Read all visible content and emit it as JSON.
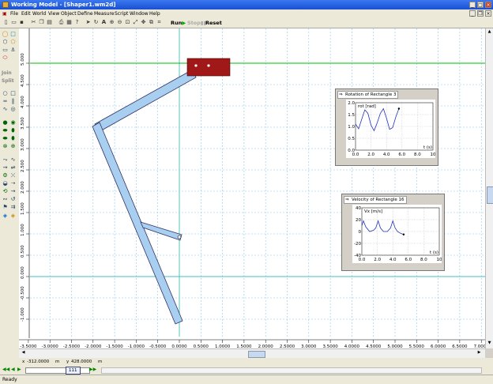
{
  "window": {
    "title": "Working Model - [Shaper1.wm2d]"
  },
  "menu": [
    "File",
    "Edit",
    "World",
    "View",
    "Object",
    "Define",
    "Measure",
    "Script",
    "Window",
    "Help"
  ],
  "toolbar": {
    "run_label": "Run",
    "stop_label": "Stop",
    "reset_label": "Reset"
  },
  "palette": {
    "join_label": "Join",
    "split_label": "Split"
  },
  "canvas": {
    "x_ticks": [
      "-4.000",
      "-3.5000",
      "-3.0000",
      "-2.5000",
      "-2.0000",
      "-1.5000",
      "-1.0000",
      "-0.5000",
      "0.0000",
      "0.5000",
      "1.0000",
      "1.5000",
      "2.0000",
      "2.5000",
      "3.0000",
      "3.5000",
      "4.0000",
      "4.5000",
      "5.0000",
      "5.5000",
      "6.0000",
      "6.5000",
      "7.0000"
    ],
    "y_ticks": [
      "5.000",
      "4.500",
      "4.000",
      "3.500",
      "3.000",
      "2.500",
      "2.000",
      "1.500",
      "1.000",
      "0.500",
      "0.000",
      "-0.500",
      "-1.000",
      "-1.500"
    ],
    "accent_horizontal": "#00c000",
    "link_fill": "#a8cff0",
    "block_fill": "#a01818"
  },
  "meter1": {
    "title": "Rotation of Rectangle 3",
    "ylabel": "rot [rad]",
    "xlabel": "t (s)",
    "y_ticks": [
      "2.0",
      "1.5",
      "1.0",
      "0.5",
      "0.0"
    ],
    "x_ticks": [
      "0.0",
      "2.0",
      "4.0",
      "6.0",
      "8.0",
      "10"
    ],
    "chart_data": {
      "type": "line",
      "xlim": [
        0,
        10
      ],
      "ylim": [
        0,
        2.0
      ],
      "x": [
        0,
        0.4,
        0.8,
        1.2,
        1.6,
        2.0,
        2.4,
        2.8,
        3.2,
        3.6,
        4.0,
        4.4,
        4.8,
        5.2,
        5.6
      ],
      "y": [
        1.1,
        0.9,
        1.3,
        1.7,
        1.55,
        1.05,
        0.82,
        1.15,
        1.55,
        1.75,
        1.35,
        0.88,
        0.95,
        1.4,
        1.75
      ]
    }
  },
  "meter2": {
    "title": "Velocity of Rectangle 16",
    "ylabel": "Vx [m/s]",
    "xlabel": "t (s)",
    "y_ticks": [
      "40",
      "20",
      "0",
      "-20",
      "-40"
    ],
    "x_ticks": [
      "0.0",
      "2.0",
      "4.0",
      "6.0",
      "8.0",
      "10"
    ],
    "chart_data": {
      "type": "line",
      "xlim": [
        0,
        10
      ],
      "ylim": [
        -40,
        40
      ],
      "x": [
        0,
        0.2,
        0.5,
        1.0,
        1.5,
        1.8,
        2.1,
        2.4,
        2.8,
        3.3,
        3.7,
        4.0,
        4.3,
        4.6,
        5.0,
        5.4
      ],
      "y": [
        10,
        18,
        8,
        0,
        2,
        6,
        18,
        6,
        0,
        0,
        6,
        18,
        6,
        0,
        -3,
        -5
      ]
    }
  },
  "coords": {
    "x_label": "x",
    "x_value": "-312.0000",
    "x_unit": "m",
    "y_label": "y",
    "y_value": "428.0000",
    "y_unit": "m"
  },
  "tape": {
    "frame": "111"
  },
  "status": {
    "text": "Ready"
  }
}
